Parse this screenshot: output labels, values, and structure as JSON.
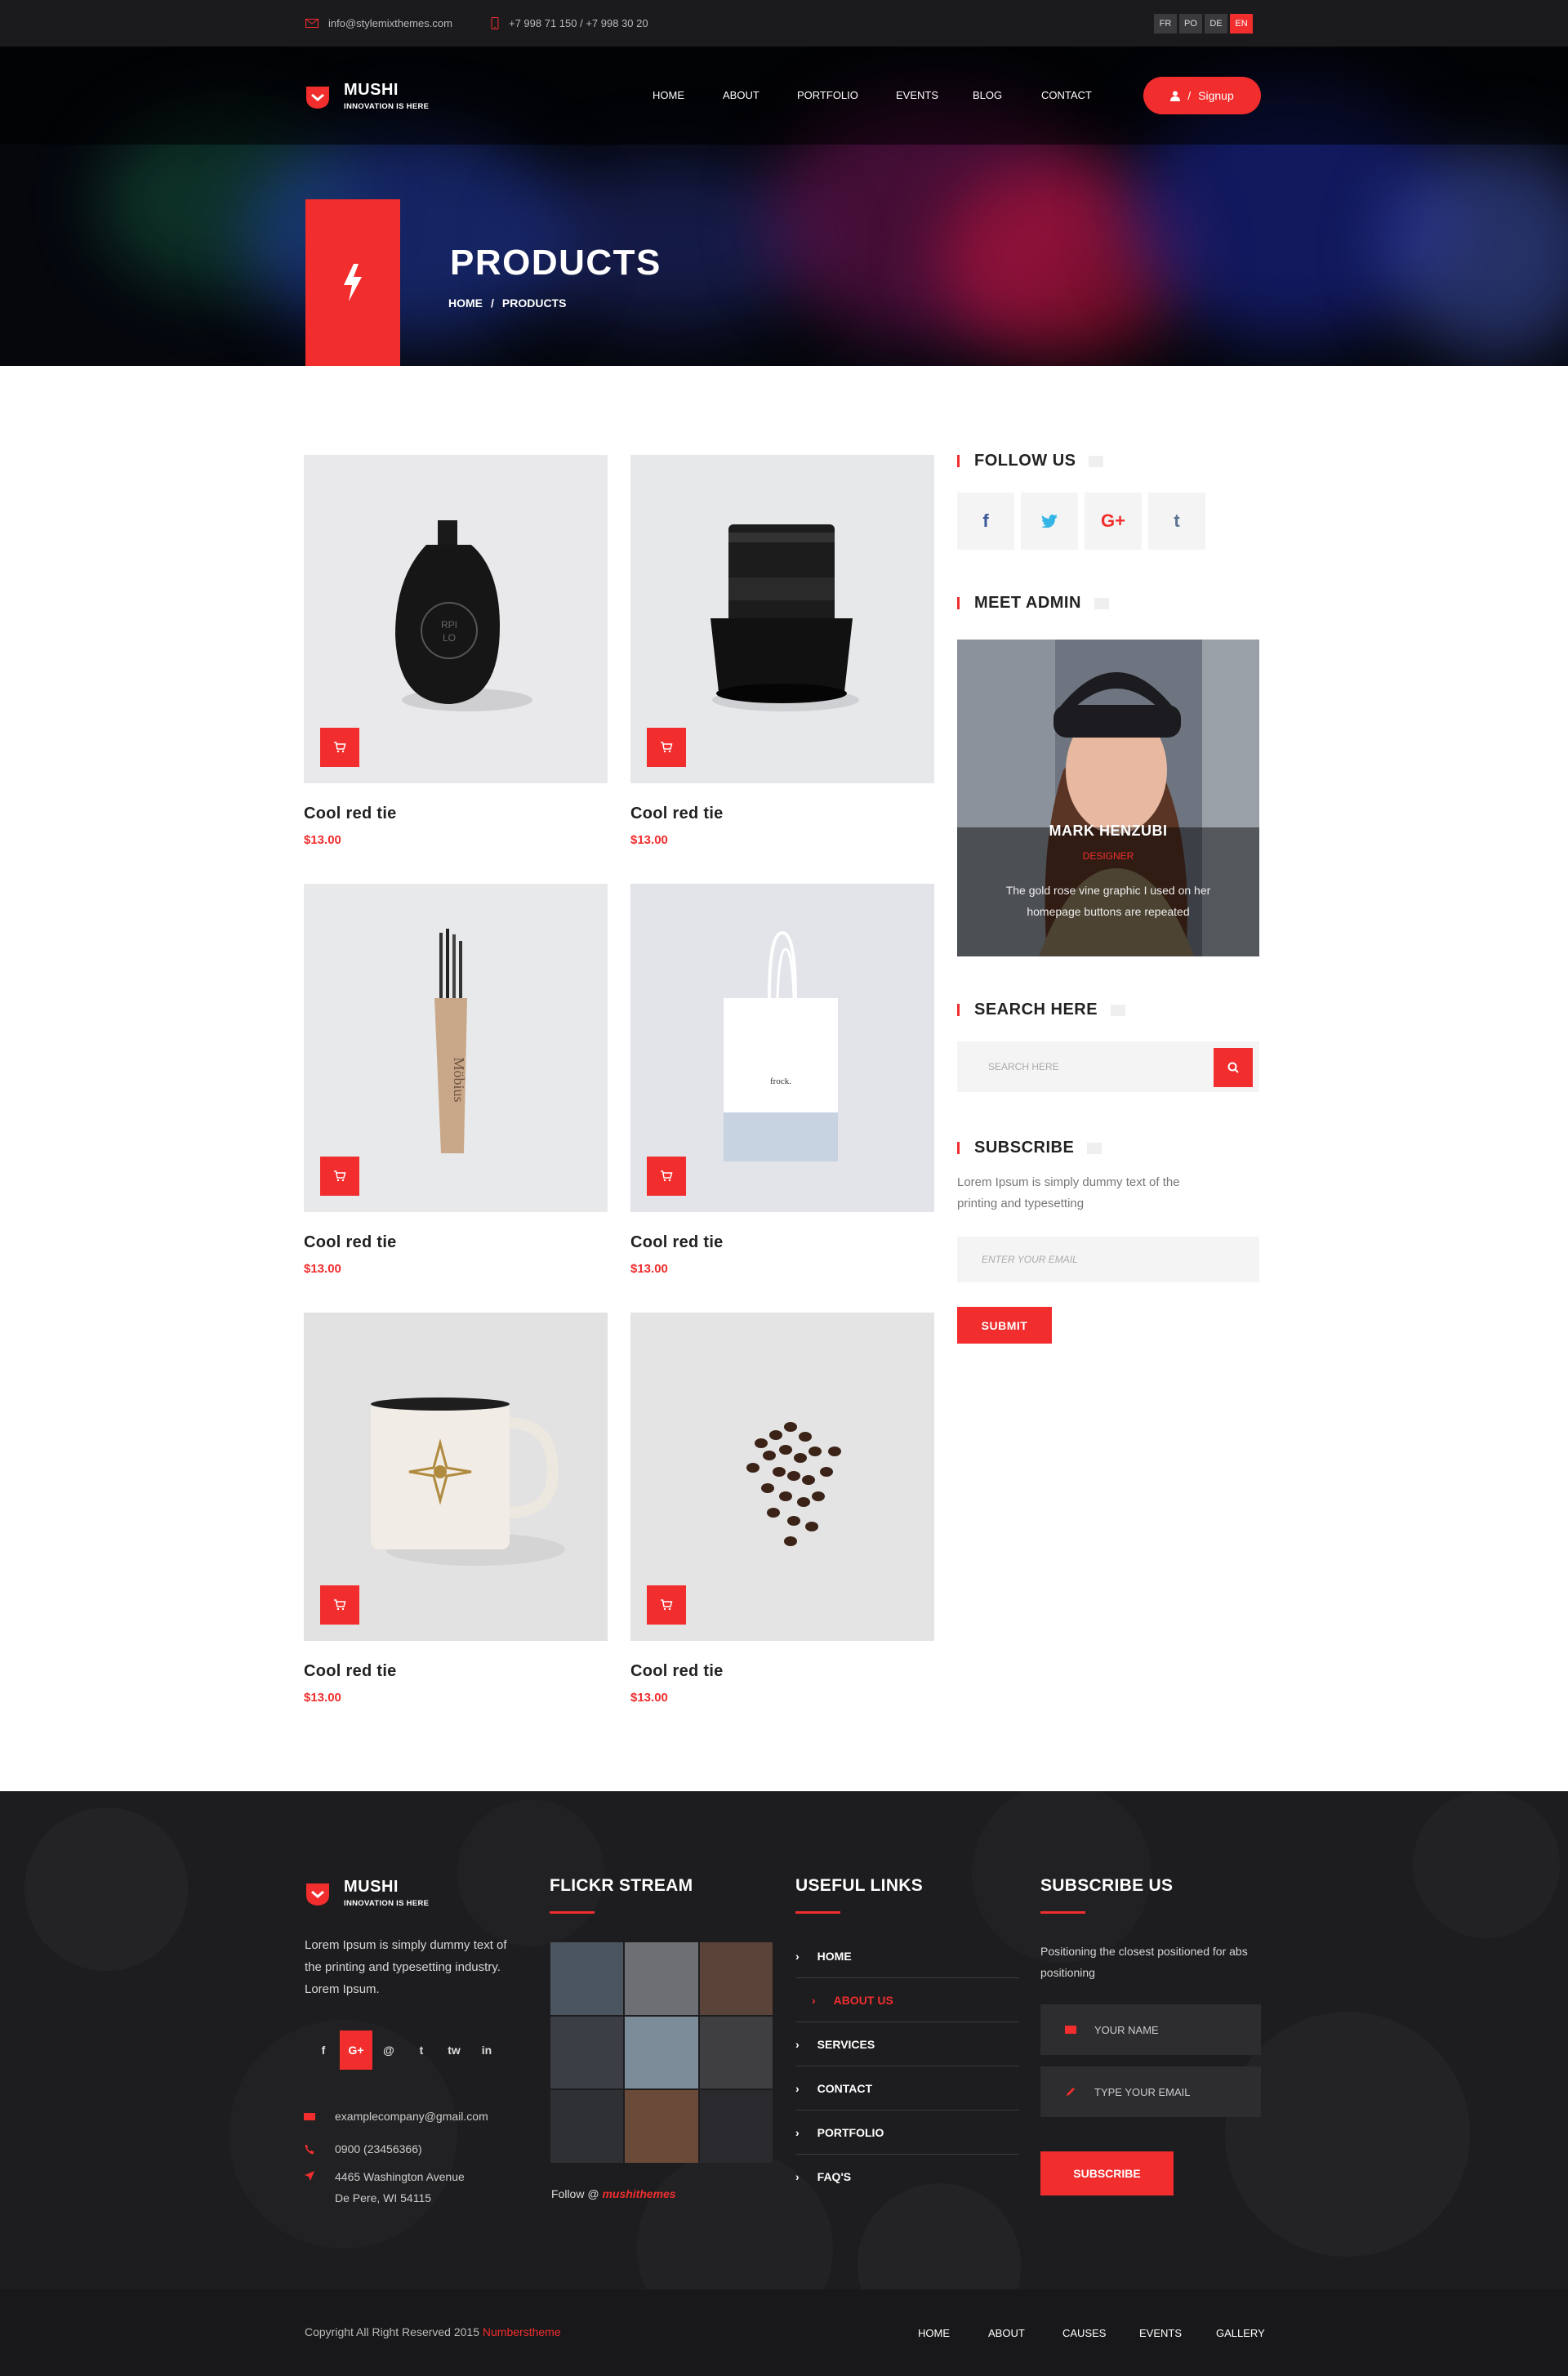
{
  "topbar": {
    "email": "info@stylemixthemes.com",
    "phone": "+7 998 71 150  /  +7 998 30 20",
    "languages": [
      "FR",
      "PO",
      "DE",
      "EN"
    ],
    "active_language": "EN"
  },
  "brand": {
    "name": "MUSHI",
    "tagline": "INNOVATION IS HERE"
  },
  "nav": {
    "items": [
      "HOME",
      "ABOUT",
      "PORTFOLIO",
      "EVENTS",
      "BLOG",
      "CONTACT"
    ],
    "signup": "Signup",
    "signup_separator": "/"
  },
  "hero": {
    "title": "PRODUCTS",
    "crumb_home": "HOME",
    "crumb_sep": "/",
    "crumb_current": "PRODUCTS"
  },
  "products": [
    {
      "name": "Cool red tie",
      "price": "$13.00",
      "image": "black-bottle"
    },
    {
      "name": "Cool red tie",
      "price": "$13.00",
      "image": "camera-lens"
    },
    {
      "name": "Cool red tie",
      "price": "$13.00",
      "image": "brushes-mobius"
    },
    {
      "name": "Cool red tie",
      "price": "$13.00",
      "image": "tote-bag"
    },
    {
      "name": "Cool red tie",
      "price": "$13.00",
      "image": "enamel-mug"
    },
    {
      "name": "Cool red tie",
      "price": "$13.00",
      "image": "coffee-beans"
    }
  ],
  "sidebar": {
    "follow_title": "FOLLOW US",
    "social": [
      {
        "icon": "facebook-icon",
        "glyph": "f",
        "color": "#3b5998"
      },
      {
        "icon": "twitter-icon",
        "glyph": "t",
        "color": "#33b5e5"
      },
      {
        "icon": "google-plus-icon",
        "glyph": "G+",
        "color": "#f12d2d"
      },
      {
        "icon": "tumblr-icon",
        "glyph": "t",
        "color": "#5a7391"
      }
    ],
    "admin_title": "MEET ADMIN",
    "admin_name": "MARK HENZUBI",
    "admin_role": "DESIGNER",
    "admin_text": "The gold rose vine graphic I used on her homepage buttons are repeated",
    "search_title": "SEARCH HERE",
    "search_placeholder": "SEARCH HERE",
    "subscribe_title": "SUBSCRIBE",
    "subscribe_text": "Lorem Ipsum is simply dummy text of the printing and typesetting",
    "email_placeholder": "ENTER YOUR EMAIL",
    "submit": "SUBMIT"
  },
  "footer": {
    "about": "Lorem Ipsum is simply dummy text of the printing and typesetting industry. Lorem Ipsum.",
    "social": [
      "f",
      "G+",
      "@",
      "t",
      "tw",
      "in"
    ],
    "email": "examplecompany@gmail.com",
    "phone": "0900 (23456366)",
    "address1": "4465 Washington Avenue",
    "address2": "De Pere, WI 54115",
    "flickr_title_a": "FLICKR",
    "flickr_title_b": "STREAM",
    "follow_prefix": "Follow @",
    "follow_handle": "mushithemes",
    "links_title": "USEFUL LINKS",
    "links": [
      "HOME",
      "ABOUT US",
      "SERVICES",
      "CONTACT",
      "PORTFOLIO",
      "FAQ'S"
    ],
    "active_link": "ABOUT US",
    "subscribe_title": "SUBSCRIBE US",
    "subscribe_text": "Positioning the closest positioned for abs positioning",
    "name_placeholder": "YOUR NAME",
    "email_placeholder": "TYPE YOUR EMAIL",
    "subscribe_button": "SUBSCRIBE"
  },
  "copyright": {
    "text": "Copyright All Right Reserved 2015",
    "brand": "Numberstheme",
    "nav": [
      "HOME",
      "ABOUT",
      "CAUSES",
      "EVENTS",
      "GALLERY"
    ]
  },
  "colors": {
    "accent": "#f12d2d",
    "dark": "#1d1d1f"
  }
}
